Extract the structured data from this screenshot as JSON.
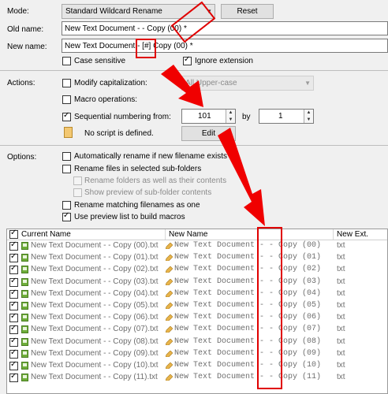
{
  "mode": {
    "label": "Mode:",
    "value": "Standard Wildcard Rename",
    "reset": "Reset"
  },
  "old_name": {
    "label": "Old name:",
    "value": "New Text Document -  - Copy (00) *"
  },
  "new_name": {
    "label": "New name:",
    "value": "New Text Document - [#]  Copy (00) *"
  },
  "checks": {
    "case_sensitive": "Case sensitive",
    "ignore_extension": "Ignore extension"
  },
  "actions": {
    "label": "Actions:",
    "modify_cap": "Modify capitalization:",
    "cap_value": "All Upper-case",
    "macro": "Macro operations:",
    "seq": "Sequential numbering from:",
    "seq_from": "101",
    "by": "by",
    "by_value": "1",
    "no_script": "No script is defined.",
    "edit": "Edit"
  },
  "options": {
    "label": "Options:",
    "auto": "Automatically rename if new filename exists",
    "subfolders": "Rename files in selected sub-folders",
    "rename_folders": "Rename folders as well as their contents",
    "show_preview": "Show preview of sub-folder contents",
    "matching": "Rename matching filenames as one",
    "preview_macros": "Use preview list to build macros"
  },
  "table": {
    "headers": {
      "current": "Current Name",
      "new": "New Name",
      "ext": "New Ext."
    },
    "rows": [
      {
        "current": "New Text Document - - Copy (00).txt",
        "new": "New Text Document -   - Copy (00)",
        "ext": "txt"
      },
      {
        "current": "New Text Document - - Copy (01).txt",
        "new": "New Text Document -   - Copy (01)",
        "ext": "txt"
      },
      {
        "current": "New Text Document - - Copy (02).txt",
        "new": "New Text Document -   - Copy (02)",
        "ext": "txt"
      },
      {
        "current": "New Text Document - - Copy (03).txt",
        "new": "New Text Document -   - Copy (03)",
        "ext": "txt"
      },
      {
        "current": "New Text Document - - Copy (04).txt",
        "new": "New Text Document -   - Copy (04)",
        "ext": "txt"
      },
      {
        "current": "New Text Document - - Copy (05).txt",
        "new": "New Text Document -   - Copy (05)",
        "ext": "txt"
      },
      {
        "current": "New Text Document - - Copy (06).txt",
        "new": "New Text Document -   - Copy (06)",
        "ext": "txt"
      },
      {
        "current": "New Text Document - - Copy (07).txt",
        "new": "New Text Document -   - Copy (07)",
        "ext": "txt"
      },
      {
        "current": "New Text Document - - Copy (08).txt",
        "new": "New Text Document -   - Copy (08)",
        "ext": "txt"
      },
      {
        "current": "New Text Document - - Copy (09).txt",
        "new": "New Text Document -   - Copy (09)",
        "ext": "txt"
      },
      {
        "current": "New Text Document - - Copy (10).txt",
        "new": "New Text Document -   - Copy (10)",
        "ext": "txt"
      },
      {
        "current": "New Text Document - - Copy (11).txt",
        "new": "New Text Document -   - Copy (11)",
        "ext": "txt"
      }
    ]
  },
  "colors": {
    "annotation": "#e00000"
  }
}
